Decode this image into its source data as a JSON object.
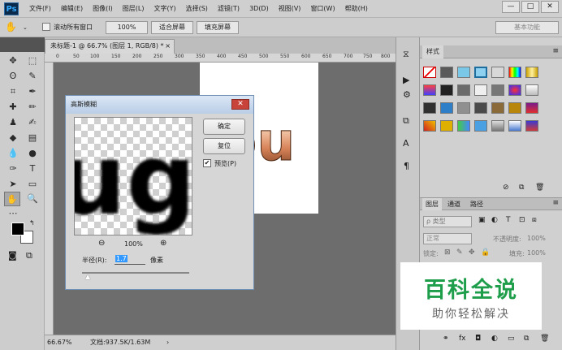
{
  "app": {
    "logo": "Ps"
  },
  "menu": [
    "文件(F)",
    "编辑(E)",
    "图像(I)",
    "图层(L)",
    "文字(Y)",
    "选择(S)",
    "滤镜(T)",
    "3D(D)",
    "视图(V)",
    "窗口(W)",
    "帮助(H)"
  ],
  "window_controls": {
    "minimize": "—",
    "maximize": "□",
    "close": "✕"
  },
  "options": {
    "scroll_all_label": "滚动所有窗口",
    "zoom_value": "100%",
    "fit_screen": "适合屏幕",
    "fill_screen": "填充屏幕",
    "workspace": "基本功能"
  },
  "document": {
    "tab_title": "未标题-1 @ 66.7% (图层 1, RGB/8) *",
    "tab_close": "×",
    "zoom": "66.67%",
    "doc_info": "文档:937.5K/1.63M",
    "canvas_text": "you"
  },
  "ruler": {
    "ticks": [
      "0",
      "50",
      "100",
      "150",
      "200",
      "250",
      "300",
      "350",
      "400",
      "450",
      "500",
      "550",
      "600",
      "650",
      "700",
      "750",
      "800"
    ]
  },
  "dialog": {
    "title": "高斯模糊",
    "close": "✕",
    "preview_text": "ug",
    "ok": "确定",
    "reset": "复位",
    "preview_label": "预览(P)",
    "preview_checked": true,
    "zoom_level": "100%",
    "zoom_out": "⊖",
    "zoom_in": "⊕",
    "radius_label": "半径(R):",
    "radius_value": "1.7",
    "radius_unit": "像素"
  },
  "styles_panel": {
    "title": "样式"
  },
  "layers_panel": {
    "tabs": [
      "图层",
      "通道",
      "路径"
    ],
    "filter_label": "ρ 类型",
    "blend_mode": "正常",
    "opacity_label": "不透明度:",
    "opacity_value": "100%",
    "lock_label": "锁定:",
    "fill_label": "填充:",
    "fill_value": "100%"
  },
  "watermark": {
    "title": "百科全说",
    "subtitle": "助你轻松解决"
  },
  "colors": {
    "accent": "#1e9e4a",
    "dialog_border": "#6f8fb3",
    "selected": "#3399ff"
  }
}
